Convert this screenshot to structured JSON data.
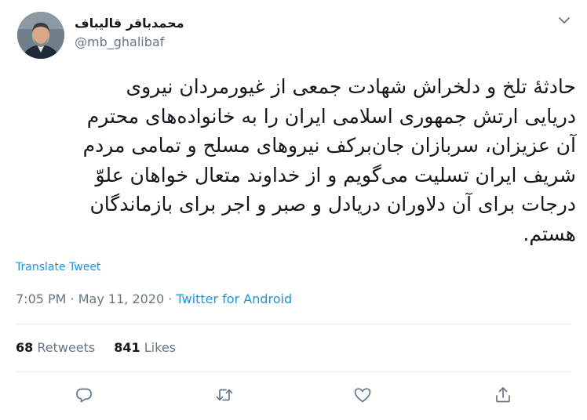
{
  "tweet": {
    "author": {
      "display_name": "محمدباقر قالیباف",
      "handle": "@mb_ghalibaf"
    },
    "text": "حادثهٔ تلخ و دلخراش شهادت جمعی از غیورمردان نیروی\nدریایی ارتش جمهوری اسلامی ایران را به خانواده‌های محترم\nآن عزیزان، سربازان جان‌برکف نیروهای مسلح و تمامی مردم\nشریف ایران تسلیت می‌گویم و از خداوند متعال خواهان علوّ\nدرجات برای آن دلاوران دریادل و صبر و اجر برای بازماندگان\nهستم.",
    "translate_label": "Translate Tweet",
    "time": "7:05 PM",
    "separator": "·",
    "date": "May 11, 2020",
    "source": "Twitter for Android",
    "retweets_count": "68",
    "retweets_label": "Retweets",
    "likes_count": "841",
    "likes_label": "Likes"
  },
  "icons": {
    "caret": "chevron-down-icon",
    "reply": "reply-icon",
    "retweet": "retweet-icon",
    "like": "heart-icon",
    "share": "share-icon"
  },
  "colors": {
    "link": "#1b95e0",
    "secondary_text": "#657786",
    "primary_text": "#14171a",
    "divider": "#e6ecf0"
  }
}
